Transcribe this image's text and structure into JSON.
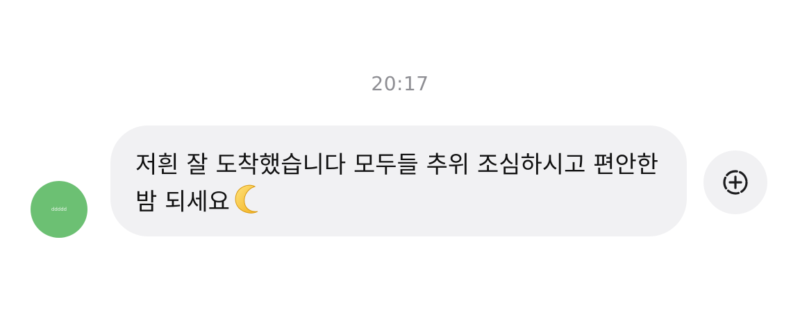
{
  "conversation": {
    "timestamp": "20:17"
  },
  "sender": {
    "avatar_color": "#6cc073",
    "avatar_text": "ddddd"
  },
  "message": {
    "text": "저흰 잘 도착했습니다 모두들 추위 조심하시고 편안한 밤 되세요",
    "emoji": "crescent-moon-icon",
    "bubble_color": "#f1f1f3"
  },
  "reaction_button": {
    "icon": "add-reaction-icon"
  }
}
